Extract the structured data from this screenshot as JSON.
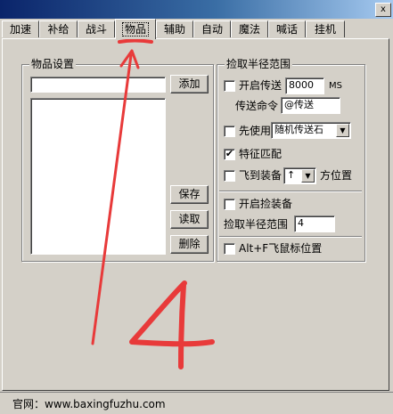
{
  "tabs": [
    "加速",
    "补给",
    "战斗",
    "物品",
    "辅助",
    "自动",
    "魔法",
    "喊话",
    "挂机"
  ],
  "active_tab": "物品",
  "window": {
    "close_label": "x"
  },
  "items_group": {
    "title": "物品设置",
    "add_button": "添加",
    "save_button": "保存",
    "load_button": "读取",
    "delete_button": "删除"
  },
  "pickup_group": {
    "title": "捡取半径范围",
    "enable_teleport": {
      "label": "开启传送",
      "checked": false
    },
    "teleport_distance": "8000",
    "ms_unit": "MS",
    "teleport_command_label": "传送命令",
    "teleport_command": "@传送",
    "use_first": {
      "label": "先使用",
      "checked": false
    },
    "use_first_item": "随机传送石",
    "feature_match": {
      "label": "特征匹配",
      "checked": true
    },
    "fly_to_equip": {
      "label": "飞到装备",
      "checked": false
    },
    "direction_value": "↑",
    "direction_suffix": "方位置",
    "enable_pickup": {
      "label": "开启捡装备",
      "checked": false
    },
    "pickup_radius_label": "捡取半径范围",
    "pickup_radius": "4",
    "alt_f_fly": {
      "label": "Alt+F飞鼠标位置",
      "checked": false
    }
  },
  "annotation": {
    "number": "4",
    "color": "#e83a3a"
  },
  "status_bar": {
    "text": "官网：www.baxingfuzhu.com"
  }
}
